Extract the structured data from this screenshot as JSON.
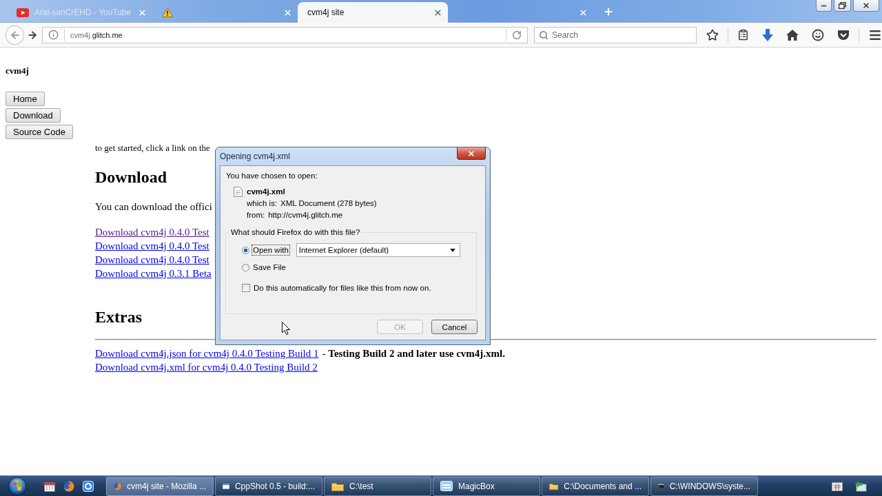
{
  "browser": {
    "tabs": [
      {
        "kind": "video",
        "title": "Arai-sanCrEHD - YouTube",
        "selected": false
      },
      {
        "kind": "warning",
        "selected": false
      },
      {
        "kind": "plain",
        "title": "cvm4j site",
        "selected": true
      },
      {
        "kind": "plain",
        "selected": false
      }
    ],
    "address_bar": {
      "url_subdomain": "cvm4j.",
      "url_domain": "glitch.me"
    },
    "search": {
      "placeholder": "Search"
    }
  },
  "page": {
    "site_title": "cvm4j",
    "nav_buttons": [
      "Home",
      "Download",
      "Source Code"
    ],
    "intro": "to get started, click a link on the",
    "download": {
      "heading": "Download",
      "text": "You can download the offici",
      "links": [
        {
          "label": "Download cvm4j 0.4.0 Test",
          "visited": true
        },
        {
          "label": "Download cvm4j 0.4.0 Test",
          "visited": false
        },
        {
          "label": "Download cvm4j 0.4.0 Test",
          "visited": false
        },
        {
          "label": "Download cvm4j 0.3.1 Beta",
          "visited": false
        }
      ]
    },
    "extras": {
      "heading": "Extras",
      "lines": [
        {
          "link": {
            "label": "Download cvm4j.json for cvm4j 0.4.0 Testing Build 1",
            "visited": false
          },
          "note": "- **Testing Build 2 and later use cvm4j.xml.**"
        },
        {
          "link": {
            "label": "Download cvm4j.xml for cvm4j 0.4.0 Testing Build 2",
            "visited": false
          }
        }
      ]
    }
  },
  "dialog": {
    "title": "Opening cvm4j.xml",
    "intro": "You have chosen to open:",
    "file_name": "cvm4j.xml",
    "details": [
      {
        "label": "which is:",
        "value": "XML Document (278 bytes)"
      },
      {
        "label": "from:",
        "value": "http://cvm4j.glitch.me"
      }
    ],
    "question": "What should Firefox do with this file?",
    "options": [
      {
        "label": "Open with",
        "selected": true,
        "focused": true,
        "app": "Internet Explorer (default)"
      },
      {
        "label": "Save File",
        "selected": false,
        "focused": false
      }
    ],
    "auto_checkbox": {
      "label": "Do this automatically for files like this from now on.",
      "checked": false
    },
    "buttons": [
      {
        "label": "OK",
        "disabled": true
      },
      {
        "label": "Cancel",
        "disabled": false
      }
    ]
  },
  "taskbar": {
    "tasks": [
      {
        "kind": "browser",
        "label": "cvm4j site - Mozilla ...",
        "selected": true
      },
      {
        "kind": "window",
        "label": "CppShot 0.5 - build:...",
        "selected": false
      },
      {
        "kind": "folder",
        "label": "C:\\test",
        "selected": false
      },
      {
        "kind": "app",
        "label": "MagicBox",
        "selected": false
      },
      {
        "kind": "folder",
        "label": "C:\\Documents and ...",
        "selected": false
      },
      {
        "kind": "console",
        "label": "C:\\WINDOWS\\syste...",
        "selected": false
      }
    ]
  }
}
